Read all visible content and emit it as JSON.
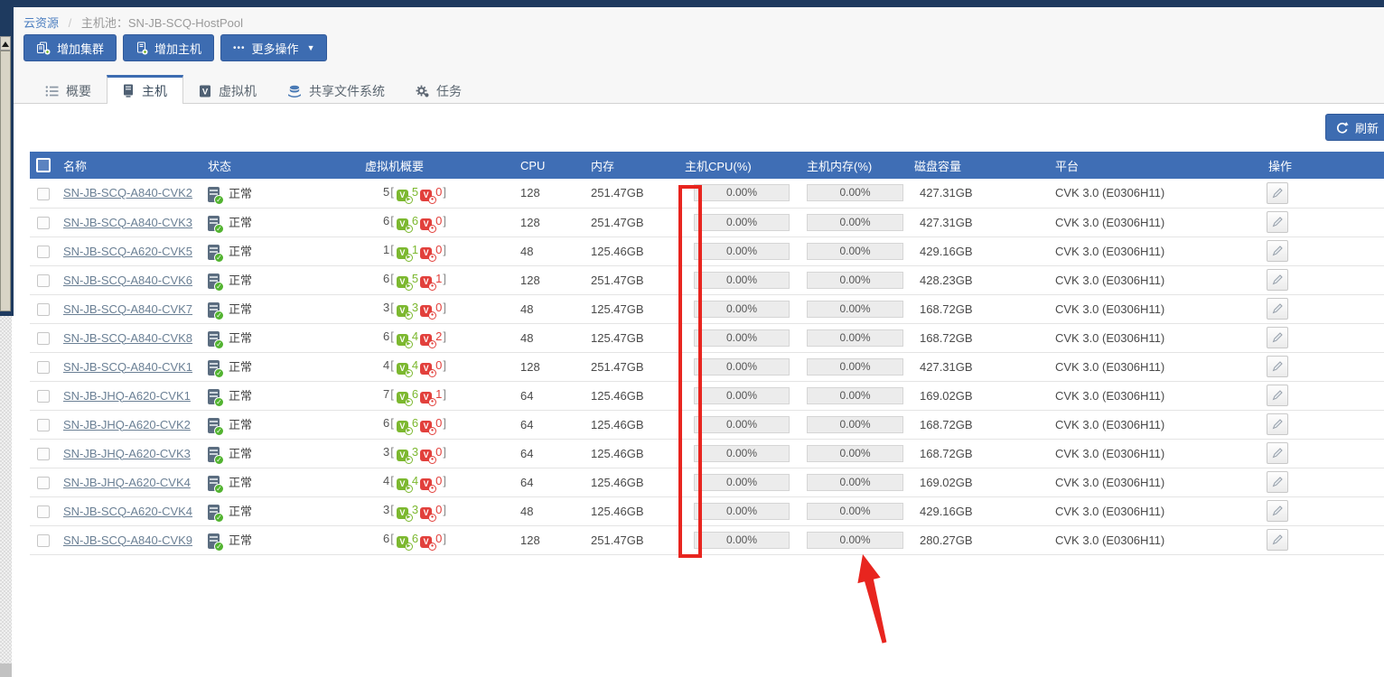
{
  "breadcrumb": {
    "root": "云资源",
    "separator": "/",
    "current": "主机池：SN-JB-SCQ-HostPool"
  },
  "toolbar": {
    "add_cluster": "增加集群",
    "add_host": "增加主机",
    "more_operations": "更多操作",
    "ellipsis": "•••",
    "caret": "▼"
  },
  "tabs": [
    {
      "label": "概要",
      "active": false
    },
    {
      "label": "主机",
      "active": true
    },
    {
      "label": "虚拟机",
      "active": false
    },
    {
      "label": "共享文件系统",
      "active": false
    },
    {
      "label": "任务",
      "active": false
    }
  ],
  "refresh": {
    "label": "刷新"
  },
  "table": {
    "columns": [
      "名称",
      "状态",
      "虚拟机概要",
      "CPU",
      "内存",
      "主机CPU(%)",
      "主机内存(%)",
      "磁盘容量",
      "平台",
      "操作"
    ],
    "rows": [
      {
        "name": "SN-JB-SCQ-A840-CVK2",
        "status": "正常",
        "vm_total": "5",
        "vm_running": "5",
        "vm_stopped": "0",
        "cpu": "128",
        "memory": "251.47GB",
        "host_cpu_pct": "0.00%",
        "host_mem_pct": "0.00%",
        "disk": "427.31GB",
        "platform": "CVK 3.0 (E0306H11)"
      },
      {
        "name": "SN-JB-SCQ-A840-CVK3",
        "status": "正常",
        "vm_total": "6",
        "vm_running": "6",
        "vm_stopped": "0",
        "cpu": "128",
        "memory": "251.47GB",
        "host_cpu_pct": "0.00%",
        "host_mem_pct": "0.00%",
        "disk": "427.31GB",
        "platform": "CVK 3.0 (E0306H11)"
      },
      {
        "name": "SN-JB-SCQ-A620-CVK5",
        "status": "正常",
        "vm_total": "1",
        "vm_running": "1",
        "vm_stopped": "0",
        "cpu": "48",
        "memory": "125.46GB",
        "host_cpu_pct": "0.00%",
        "host_mem_pct": "0.00%",
        "disk": "429.16GB",
        "platform": "CVK 3.0 (E0306H11)"
      },
      {
        "name": "SN-JB-SCQ-A840-CVK6",
        "status": "正常",
        "vm_total": "6",
        "vm_running": "5",
        "vm_stopped": "1",
        "cpu": "128",
        "memory": "251.47GB",
        "host_cpu_pct": "0.00%",
        "host_mem_pct": "0.00%",
        "disk": "428.23GB",
        "platform": "CVK 3.0 (E0306H11)"
      },
      {
        "name": "SN-JB-SCQ-A840-CVK7",
        "status": "正常",
        "vm_total": "3",
        "vm_running": "3",
        "vm_stopped": "0",
        "cpu": "48",
        "memory": "125.47GB",
        "host_cpu_pct": "0.00%",
        "host_mem_pct": "0.00%",
        "disk": "168.72GB",
        "platform": "CVK 3.0 (E0306H11)"
      },
      {
        "name": "SN-JB-SCQ-A840-CVK8",
        "status": "正常",
        "vm_total": "6",
        "vm_running": "4",
        "vm_stopped": "2",
        "cpu": "48",
        "memory": "125.47GB",
        "host_cpu_pct": "0.00%",
        "host_mem_pct": "0.00%",
        "disk": "168.72GB",
        "platform": "CVK 3.0 (E0306H11)"
      },
      {
        "name": "SN-JB-SCQ-A840-CVK1",
        "status": "正常",
        "vm_total": "4",
        "vm_running": "4",
        "vm_stopped": "0",
        "cpu": "128",
        "memory": "251.47GB",
        "host_cpu_pct": "0.00%",
        "host_mem_pct": "0.00%",
        "disk": "427.31GB",
        "platform": "CVK 3.0 (E0306H11)"
      },
      {
        "name": "SN-JB-JHQ-A620-CVK1",
        "status": "正常",
        "vm_total": "7",
        "vm_running": "6",
        "vm_stopped": "1",
        "cpu": "64",
        "memory": "125.46GB",
        "host_cpu_pct": "0.00%",
        "host_mem_pct": "0.00%",
        "disk": "169.02GB",
        "platform": "CVK 3.0 (E0306H11)"
      },
      {
        "name": "SN-JB-JHQ-A620-CVK2",
        "status": "正常",
        "vm_total": "6",
        "vm_running": "6",
        "vm_stopped": "0",
        "cpu": "64",
        "memory": "125.46GB",
        "host_cpu_pct": "0.00%",
        "host_mem_pct": "0.00%",
        "disk": "168.72GB",
        "platform": "CVK 3.0 (E0306H11)"
      },
      {
        "name": "SN-JB-JHQ-A620-CVK3",
        "status": "正常",
        "vm_total": "3",
        "vm_running": "3",
        "vm_stopped": "0",
        "cpu": "64",
        "memory": "125.46GB",
        "host_cpu_pct": "0.00%",
        "host_mem_pct": "0.00%",
        "disk": "168.72GB",
        "platform": "CVK 3.0 (E0306H11)"
      },
      {
        "name": "SN-JB-JHQ-A620-CVK4",
        "status": "正常",
        "vm_total": "4",
        "vm_running": "4",
        "vm_stopped": "0",
        "cpu": "64",
        "memory": "125.46GB",
        "host_cpu_pct": "0.00%",
        "host_mem_pct": "0.00%",
        "disk": "169.02GB",
        "platform": "CVK 3.0 (E0306H11)"
      },
      {
        "name": "SN-JB-SCQ-A620-CVK4",
        "status": "正常",
        "vm_total": "3",
        "vm_running": "3",
        "vm_stopped": "0",
        "cpu": "48",
        "memory": "125.46GB",
        "host_cpu_pct": "0.00%",
        "host_mem_pct": "0.00%",
        "disk": "429.16GB",
        "platform": "CVK 3.0 (E0306H11)"
      },
      {
        "name": "SN-JB-SCQ-A840-CVK9",
        "status": "正常",
        "vm_total": "6",
        "vm_running": "6",
        "vm_stopped": "0",
        "cpu": "128",
        "memory": "251.47GB",
        "host_cpu_pct": "0.00%",
        "host_mem_pct": "0.00%",
        "disk": "280.27GB",
        "platform": "CVK 3.0 (E0306H11)"
      }
    ]
  },
  "icons": {
    "check": "✓",
    "play": "▶",
    "stop": "●",
    "up_arrow": "▲"
  },
  "colors": {
    "header_blue": "#3f6eb5",
    "button_blue": "#3d6cb1",
    "navy_edge": "#1e3a5f",
    "annotation_red": "#e8251f",
    "vm_running_green": "#7cb82f",
    "vm_stopped_red": "#e2403c",
    "status_ok_green": "#52b330"
  }
}
